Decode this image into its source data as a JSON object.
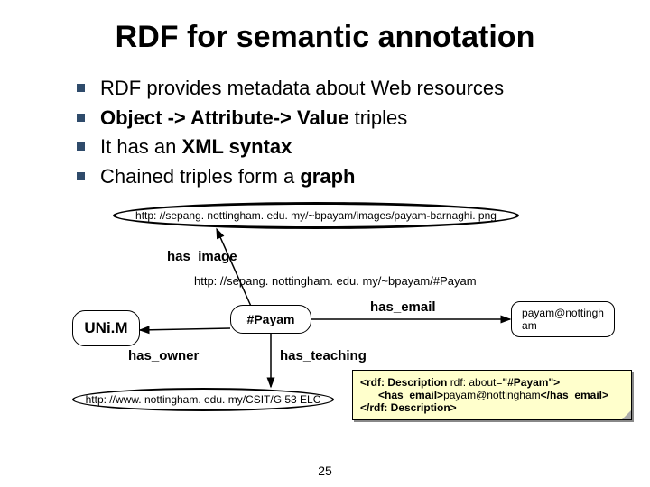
{
  "title": "RDF for semantic annotation",
  "bullets": [
    {
      "plain": "RDF provides metadata about Web resources"
    },
    {
      "plain_html": "<span class='bold'>Object -&gt; Attribute-&gt; Value </span>triples"
    },
    {
      "plain_html": "It has an <span class='bold'>XML syntax</span>"
    },
    {
      "plain_html": "Chained triples form a <span class='bold'>graph</span>"
    }
  ],
  "diagram": {
    "nodes": {
      "topImage": "http: //sepang. nottingham. edu. my/~bpayam/images/payam-barnaghi. png",
      "payamUrl": "http: //sepang. nottingham. edu. my/~bpayam/#Payam",
      "payam": "#Payam",
      "unim": "UNi.M",
      "email": "payam@nottingh\nam",
      "teaching": "http: //www. nottingham. edu. my/CSIT/G 53 ELC"
    },
    "edges": {
      "hasImage": "has_image",
      "hasEmail": "has_email",
      "hasOwner": "has_owner",
      "hasTeaching": "has_teaching"
    }
  },
  "code": {
    "line1a": "<rdf: Description ",
    "line1b": "rdf: about=",
    "line1c": "\"#Payam\">",
    "line2a": "<has_email>",
    "line2b": "payam@nottingham",
    "line2c": "</has_email>",
    "line3": "</rdf: Description>"
  },
  "page": "25"
}
